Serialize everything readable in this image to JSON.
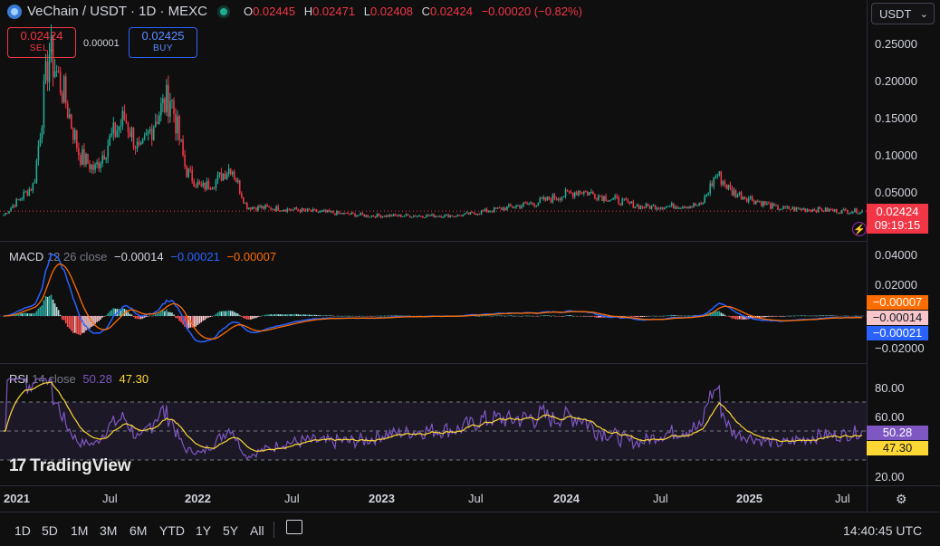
{
  "header": {
    "symbol": "VeChain / USDT · 1D · MEXC",
    "ohlc": [
      {
        "key": "O",
        "value": "0.02445"
      },
      {
        "key": "H",
        "value": "0.02471"
      },
      {
        "key": "L",
        "value": "0.02408"
      },
      {
        "key": "C",
        "value": "0.02424"
      }
    ],
    "change": "−0.00020 (−0.82%)"
  },
  "trade": {
    "sell_price": "0.02424",
    "sell_label": "SELL",
    "buy_price": "0.02425",
    "buy_label": "BUY",
    "spread": "0.00001"
  },
  "currency_select": "USDT",
  "price_axis": [
    "0.25000",
    "0.20000",
    "0.15000",
    "0.10000",
    "0.05000"
  ],
  "last_price_tag": {
    "price": "0.02424",
    "countdown": "09:19:15"
  },
  "macd": {
    "title": "MACD",
    "params": "12 26 close",
    "hist": "−0.00014",
    "macd": "−0.00021",
    "signal": "−0.00007",
    "axis": [
      "0.04000",
      "0.02000",
      "−0.02000"
    ],
    "tags": {
      "signal": "−0.00007",
      "hist": "−0.00014",
      "macd": "−0.00021"
    }
  },
  "rsi": {
    "title": "RSI",
    "params": "14 close",
    "rsi": "50.28",
    "ma": "47.30",
    "axis": [
      "80.00",
      "60.00",
      "20.00"
    ],
    "tags": {
      "rsi": "50.28",
      "ma": "47.30"
    }
  },
  "time_axis": [
    "2021",
    "Jul",
    "2022",
    "Jul",
    "2023",
    "Jul",
    "2024",
    "Jul",
    "2025",
    "Jul"
  ],
  "watermark": "TradingView",
  "timeframes": [
    "1D",
    "5D",
    "1M",
    "3M",
    "6M",
    "YTD",
    "1Y",
    "5Y",
    "All"
  ],
  "clock": "14:40:45 UTC",
  "colors": {
    "up": "#22ab94",
    "down": "#f23645",
    "macd": "#2962ff",
    "signal": "#ff6d00",
    "rsi": "#7e57c2",
    "rsi_ma": "#fdd835",
    "bg": "#0f0f10"
  },
  "chart_data": {
    "type": "line",
    "title": "VeChain / USDT · 1D · MEXC",
    "x": [
      "2021-01",
      "2021-03",
      "2021-04",
      "2021-05",
      "2021-06",
      "2021-07",
      "2021-08",
      "2021-09",
      "2021-10",
      "2021-11",
      "2021-12",
      "2022-01",
      "2022-02",
      "2022-03",
      "2022-04",
      "2022-05",
      "2022-07",
      "2023-01",
      "2023-07",
      "2023-12",
      "2024-03",
      "2024-07",
      "2024-11",
      "2024-12",
      "2025-01",
      "2025-04",
      "2025-07",
      "2025-08"
    ],
    "series": [
      {
        "values": [
          0.019,
          0.06,
          0.24,
          0.18,
          0.1,
          0.08,
          0.12,
          0.15,
          0.1,
          0.15,
          0.18,
          0.08,
          0.055,
          0.065,
          0.085,
          0.03,
          0.028,
          0.018,
          0.018,
          0.035,
          0.052,
          0.03,
          0.032,
          0.075,
          0.05,
          0.028,
          0.026,
          0.02424
        ]
      }
    ],
    "ylim": [
      0,
      0.27
    ],
    "grid": false
  }
}
